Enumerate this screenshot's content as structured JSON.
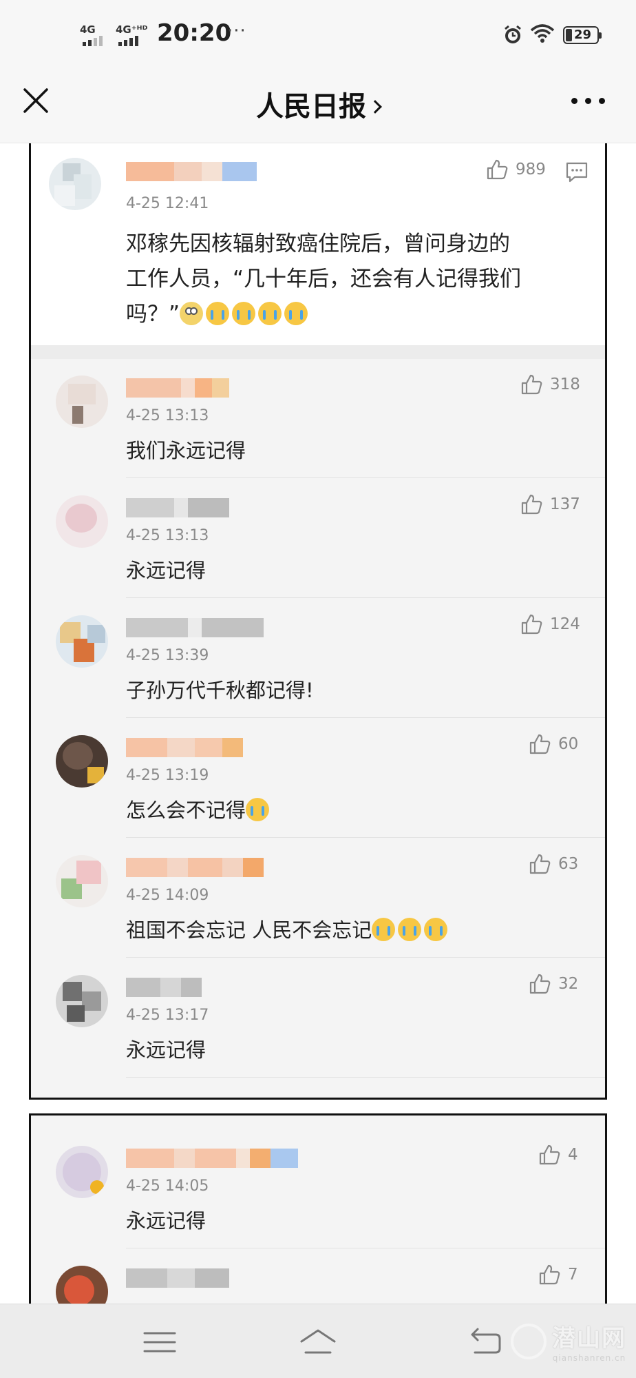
{
  "status_bar": {
    "signal1_label": "4G",
    "signal2_label": "4G⁺ᴴᴰ",
    "time": "20:20",
    "more": "···",
    "battery": "29"
  },
  "nav": {
    "title": "人民日报"
  },
  "main_comment": {
    "likes": "989",
    "time": "4-25 12:41",
    "text_line1": "邓稼先因核辐射致癌住院后，曾问身边的",
    "text_line2": "工作人员，“几十年后，还会有人记得我们",
    "text_line3": "吗？”"
  },
  "replies": [
    {
      "time": "4-25 13:13",
      "text": "我们永远记得",
      "likes": "318"
    },
    {
      "time": "4-25 13:13",
      "text": "永远记得",
      "likes": "137"
    },
    {
      "time": "4-25 13:39",
      "text": "子孙万代千秋都记得!",
      "likes": "124"
    },
    {
      "time": "4-25 13:19",
      "text": "怎么会不记得",
      "likes": "60"
    },
    {
      "time": "4-25 14:09",
      "text": "祖国不会忘记 人民不会忘记",
      "likes": "63"
    },
    {
      "time": "4-25 13:17",
      "text": "永远记得",
      "likes": "32"
    }
  ],
  "second_card": [
    {
      "time": "4-25 14:05",
      "text": "永远记得",
      "likes": "4"
    },
    {
      "likes": "7"
    }
  ],
  "watermark": {
    "main": "潜山网",
    "sub": "qianshanren.cn"
  },
  "colors": {
    "accent_username": "#f3a27a",
    "blurred_gray": "#bdbdbd",
    "emoji": "#f7c744",
    "tear": "#4aa3e6"
  }
}
